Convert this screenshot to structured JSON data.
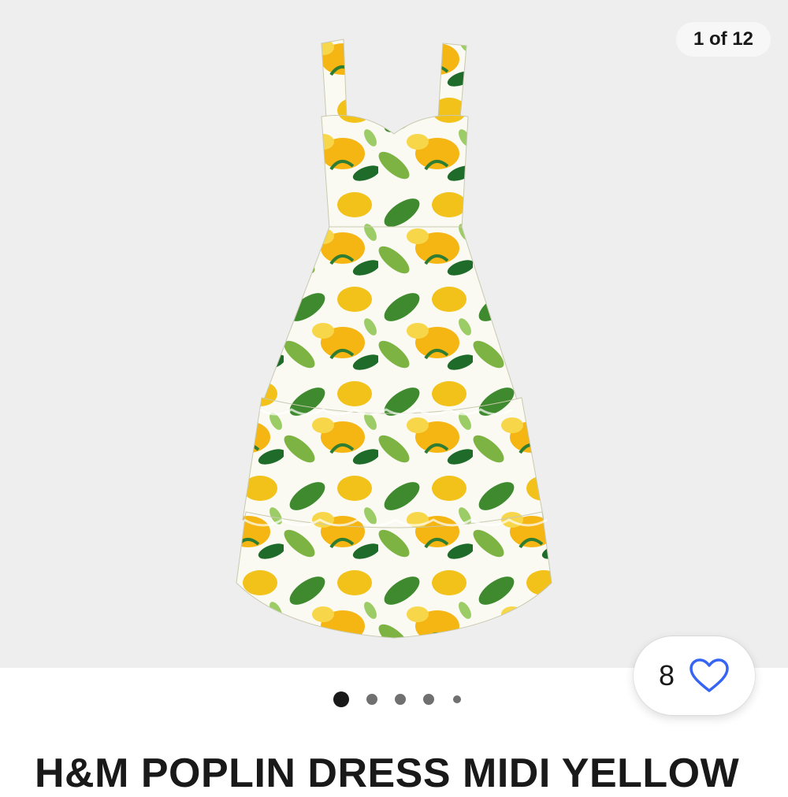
{
  "gallery": {
    "counter": "1 of 12",
    "image_alt": "Yellow floral tiered poplin midi dress",
    "dots": [
      {
        "active": true
      },
      {
        "active": false
      },
      {
        "active": false
      },
      {
        "active": false
      },
      {
        "active": false
      }
    ]
  },
  "favorite": {
    "count": "8",
    "icon": "heart-outline-icon",
    "color": "#3665f3"
  },
  "listing": {
    "title": "H&M POPLIN DRESS MIDI YELLOW"
  },
  "colors": {
    "text": "#191919",
    "gallery_bg": "#eeeeee",
    "accent": "#3665f3"
  }
}
